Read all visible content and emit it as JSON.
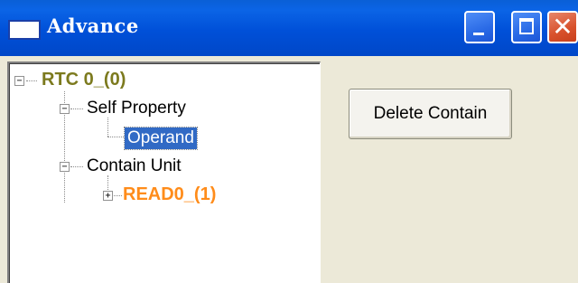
{
  "window": {
    "title": "Advance",
    "controls": [
      "minimize-icon",
      "maximize-icon",
      "close-icon"
    ]
  },
  "tree": {
    "root": {
      "label": "RTC 0_(0)",
      "expanded": true,
      "color": "#7c7a1e"
    },
    "self_property": {
      "label": "Self Property",
      "expanded": true
    },
    "operand": {
      "label": "Operand",
      "selected": true
    },
    "contain_unit": {
      "label": "Contain Unit",
      "expanded": true
    },
    "read0": {
      "label": "READ0_(1)",
      "expanded": false,
      "color": "#ff8c1a"
    }
  },
  "actions": {
    "delete_contain_label": "Delete Contain"
  },
  "colors": {
    "titlebar": "#0050d8",
    "background": "#ece9d8",
    "selection": "#316ac5"
  }
}
